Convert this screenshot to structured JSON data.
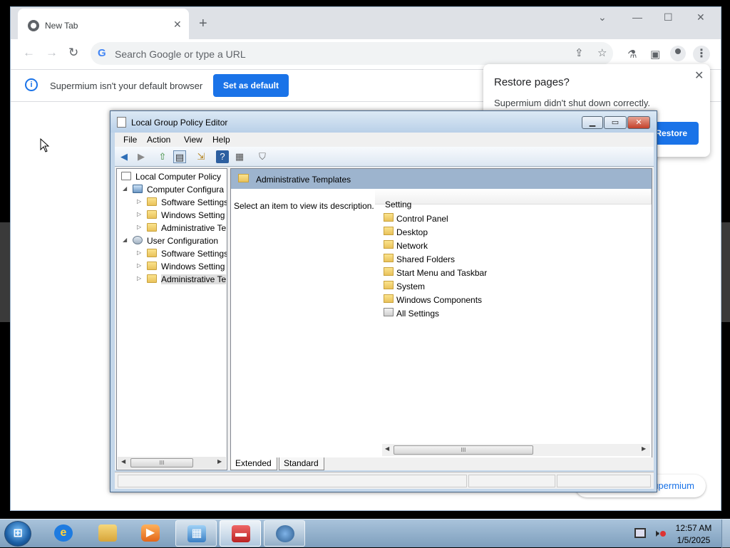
{
  "browser": {
    "tab_title": "New Tab",
    "omnibox_placeholder": "Search Google or type a URL",
    "infobar": {
      "message": "Supermium isn't your default browser",
      "button": "Set as default"
    },
    "chip_text": "Supermium"
  },
  "restore_popup": {
    "title": "Restore pages?",
    "message": "Supermium didn't shut down correctly.",
    "button": "Restore"
  },
  "gpe": {
    "title": "Local Group Policy Editor",
    "menu": [
      "File",
      "Action",
      "View",
      "Help"
    ],
    "tree": [
      {
        "label": "Local Computer Policy",
        "icon": "policy-icon"
      },
      {
        "label": "Computer Configura",
        "icon": "computer-icon"
      },
      {
        "label": "Software Settings",
        "icon": "folder-icon"
      },
      {
        "label": "Windows Setting",
        "icon": "folder-icon"
      },
      {
        "label": "Administrative Te",
        "icon": "folder-icon"
      },
      {
        "label": "User Configuration",
        "icon": "user-icon"
      },
      {
        "label": "Software Settings",
        "icon": "folder-icon"
      },
      {
        "label": "Windows Setting",
        "icon": "folder-icon"
      },
      {
        "label": "Administrative Te",
        "icon": "folder-icon",
        "selected": true
      }
    ],
    "header_title": "Administrative Templates",
    "description": "Select an item to view its description.",
    "column_header": "Setting",
    "items": [
      "Control Panel",
      "Desktop",
      "Network",
      "Shared Folders",
      "Start Menu and Taskbar",
      "System",
      "Windows Components",
      "All Settings"
    ],
    "view_tabs": [
      "Extended",
      "Standard"
    ],
    "scroll_grip": "III"
  },
  "taskbar": {
    "start_glyph": "⊞",
    "time": "12:57 AM",
    "date": "1/5/2025"
  },
  "colors": {
    "accent": "#1a73e8",
    "gpe_header": "#9db4ce",
    "taskbar": "#8fb0cf"
  }
}
